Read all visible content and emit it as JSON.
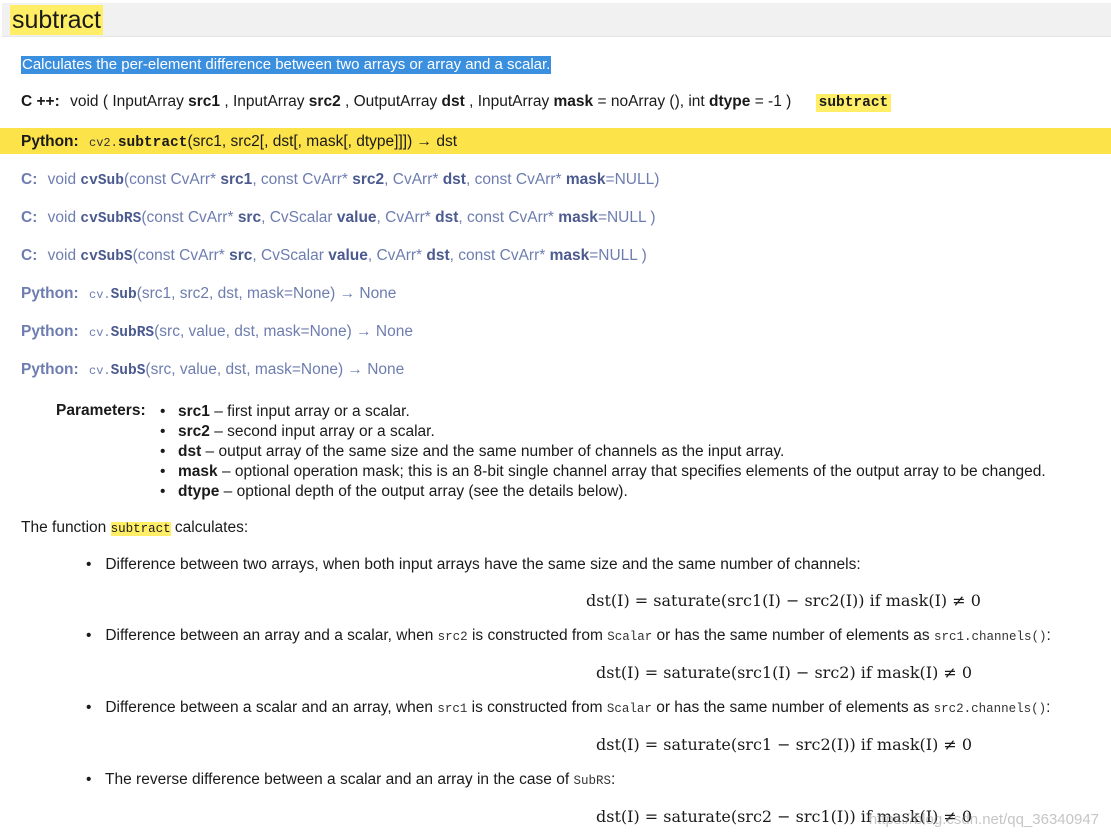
{
  "title": "subtract",
  "description": "Calculates the per-element difference between two arrays or array and a scalar.",
  "cpp": {
    "label": "C ++:",
    "ret": "void",
    "open": "(",
    "p1_type": "InputArray",
    "p1_name": "src1",
    "p2_type": ", InputArray",
    "p2_name": "src2",
    "p3_type": ", OutputArray",
    "p3_name": "dst",
    "p4_type": ", InputArray",
    "p4_name": "mask",
    "p4_default": "= noArray (), int",
    "p5_name": "dtype",
    "p5_default": "= -1 )",
    "highlight": "subtract"
  },
  "py_main": {
    "label": "Python:",
    "prefix": "cv2.",
    "fn": "subtract",
    "args": "(src1, src2[, dst[, mask[, dtype]]]) → dst"
  },
  "c_sigs": [
    {
      "label": "C:",
      "ret": "void",
      "fn": "cvSub",
      "a1": "(const CvArr* ",
      "n1": "src1",
      "a2": ", const CvArr* ",
      "n2": "src2",
      "a3": ", CvArr* ",
      "n3": "dst",
      "a4": ", const CvArr* ",
      "n4": "mask",
      "tail": "=NULL)"
    },
    {
      "label": "C:",
      "ret": "void",
      "fn": "cvSubRS",
      "a1": "(const CvArr* ",
      "n1": "src",
      "a2": ", CvScalar ",
      "n2": "value",
      "a3": ", CvArr* ",
      "n3": "dst",
      "a4": ", const CvArr* ",
      "n4": "mask",
      "tail": "=NULL )"
    },
    {
      "label": "C:",
      "ret": "void",
      "fn": "cvSubS",
      "a1": "(const CvArr* ",
      "n1": "src",
      "a2": ", CvScalar ",
      "n2": "value",
      "a3": ", CvArr* ",
      "n3": "dst",
      "a4": ", const CvArr* ",
      "n4": "mask",
      "tail": "=NULL )"
    }
  ],
  "py_old": [
    {
      "label": "Python:",
      "prefix": "cv.",
      "fn": "Sub",
      "args": "(src1, src2, dst, mask=None) → None"
    },
    {
      "label": "Python:",
      "prefix": "cv.",
      "fn": "SubRS",
      "args": "(src, value, dst, mask=None) → None"
    },
    {
      "label": "Python:",
      "prefix": "cv.",
      "fn": "SubS",
      "args": "(src, value, dst, mask=None) → None"
    }
  ],
  "parameters": {
    "label": "Parameters:",
    "items": [
      {
        "name": "src1",
        "desc": " – first input array or a scalar."
      },
      {
        "name": "src2",
        "desc": " – second input array or a scalar."
      },
      {
        "name": "dst",
        "desc": " – output array of the same size and the same number of channels as the input array."
      },
      {
        "name": "mask",
        "desc": " – optional operation mask; this is an 8-bit single channel array that specifies elements of the output array to be changed."
      },
      {
        "name": "dtype",
        "desc": " – optional depth of the output array (see the details below)."
      }
    ]
  },
  "intro": {
    "before": "The function ",
    "code": "subtract",
    "after": " calculates:"
  },
  "cases": [
    {
      "t1": "Difference between two arrays, when both input arrays have the same size and the same number of channels:",
      "formula": "dst(I) = saturate(src1(I) − src2(I))   if  mask(I) ≠ 0"
    },
    {
      "t1": "Difference between an array and a scalar, when ",
      "c1": "src2",
      "t2": " is constructed from ",
      "c2": "Scalar",
      "t3": " or has the same number of elements as ",
      "c3": "src1.channels()",
      "t4": ":",
      "formula": "dst(I) = saturate(src1(I) − src2)   if  mask(I) ≠ 0"
    },
    {
      "t1": "Difference between a scalar and an array, when ",
      "c1": "src1",
      "t2": " is constructed from ",
      "c2": "Scalar",
      "t3": " or has the same number of elements as ",
      "c3": "src2.channels()",
      "t4": ":",
      "formula": "dst(I) = saturate(src1 − src2(I))   if  mask(I) ≠ 0"
    },
    {
      "t1": "The reverse difference between a scalar and an array in the case of ",
      "c1": "SubRS",
      "t2": ":",
      "formula": "dst(I) = saturate(src2 − src1(I))   if  mask(I) ≠ 0"
    }
  ],
  "watermark": "https://blog.csdn.net/qq_36340947"
}
